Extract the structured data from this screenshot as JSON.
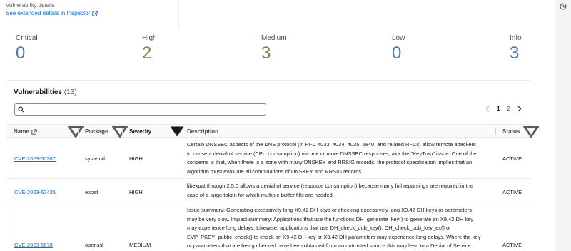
{
  "details": {
    "title": "Vulnerability details",
    "inspector_link": "See extended details in Inspector"
  },
  "rail": {
    "icon": "clock-icon"
  },
  "severity_summary": [
    {
      "label": "Critical",
      "count": "0",
      "color": "#4a7aa8"
    },
    {
      "label": "High",
      "count": "2",
      "color": "#8b7e4d"
    },
    {
      "label": "Medium",
      "count": "3",
      "color": "#8b7e4d"
    },
    {
      "label": "Low",
      "count": "0",
      "color": "#4a7aa8"
    },
    {
      "label": "Info",
      "count": "3",
      "color": "#4a7aa8"
    }
  ],
  "vulnerabilities": {
    "title": "Vulnerabilities",
    "count": "(13)",
    "search": {
      "value": "",
      "placeholder": ""
    },
    "pagination": {
      "current": "1",
      "next": "2"
    },
    "columns": {
      "name": "Name",
      "package": "Package",
      "severity": "Severity",
      "description": "Description",
      "status": "Status"
    },
    "rows": [
      {
        "id": "CVE-2023-50387",
        "package": "systemd",
        "severity": "HIGH",
        "status": "ACTIVE",
        "description_lines": [
          "Certain DNSSEC aspects of the DNS protocol (in RFC 4033, 4034, 4035, 6840, and related RFCs) allow remote attackers",
          "to cause a denial of service (CPU consumption) via one or more DNSSEC responses, aka the \"KeyTrap\" issue. One of the",
          "concerns is that, when there is a zone with many DNSKEY and RRSIG records, the protocol specification implies that an",
          "algorithm must evaluate all combinations of DNSKEY and RRSIG records."
        ]
      },
      {
        "id": "CVE-2023-52425",
        "package": "expat",
        "severity": "HIGH",
        "status": "ACTIVE",
        "description_lines": [
          "libexpat through 2.5.0 allows a denial of service (resource consumption) because many full reparsings are required in the",
          "case of a large token for which multiple buffer fills are needed."
        ]
      },
      {
        "id": "CVE-2023-5678",
        "package": "openssl",
        "severity": "MEDIUM",
        "status": "ACTIVE",
        "description_lines": [
          "Issue summary: Generating excessively long X9.42 DH keys or checking excessively long X9.42 DH keys or parameters",
          "may be very slow. Impact summary: Applications that use the functions DH_generate_key() to generate an X9.42 DH key",
          "may experience long delays. Likewise, applications that use DH_check_pub_key(), DH_check_pub_key_ex() or",
          "EVP_PKEY_public_check() to check an X9.42 DH key or X9.42 DH parameters may experience long delays. Where the key",
          "or parameters that are being checked have been obtained from an untrusted source this may lead to a Denial of Service."
        ]
      }
    ]
  }
}
